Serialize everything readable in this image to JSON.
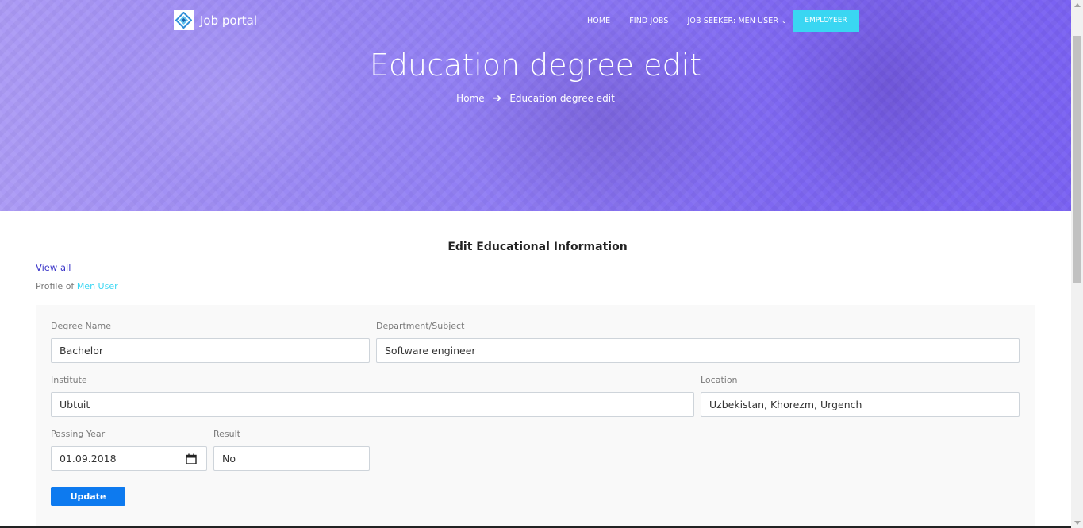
{
  "brand": {
    "name": "Job portal",
    "logo_icon": "job-portal-logo-icon"
  },
  "nav": {
    "items": [
      {
        "label": "HOME"
      },
      {
        "label": "FIND JOBS"
      },
      {
        "label": "JOB SEEKER: MEN USER",
        "icon": "chevron-down-icon"
      }
    ],
    "employer_label": "EMPLOYEER"
  },
  "hero": {
    "title": "Education degree edit",
    "breadcrumb": {
      "home": "Home",
      "separator_icon": "arrow-right-icon",
      "current": "Education degree edit"
    }
  },
  "page": {
    "section_title": "Edit Educational Information",
    "view_all": "View all",
    "profile_prefix": "Profile of",
    "profile_name": "Men User"
  },
  "form": {
    "degree_name": {
      "label": "Degree Name",
      "value": "Bachelor"
    },
    "department": {
      "label": "Department/Subject",
      "value": "Software engineer"
    },
    "institute": {
      "label": "Institute",
      "value": "Ubtuit"
    },
    "location": {
      "label": "Location",
      "value": "Uzbekistan, Khorezm, Urgench"
    },
    "passing_year": {
      "label": "Passing Year",
      "value": "01.09.2018",
      "icon": "calendar-icon"
    },
    "result": {
      "label": "Result",
      "value": "No"
    },
    "submit_label": "Update"
  },
  "colors": {
    "hero_gradient_start": "#ac9bf5",
    "hero_gradient_end": "#7a62f2",
    "employer_button": "#3ad6f2",
    "update_button": "#0d7aef",
    "link": "#3a35c8",
    "profile_name": "#3ad6f2"
  }
}
